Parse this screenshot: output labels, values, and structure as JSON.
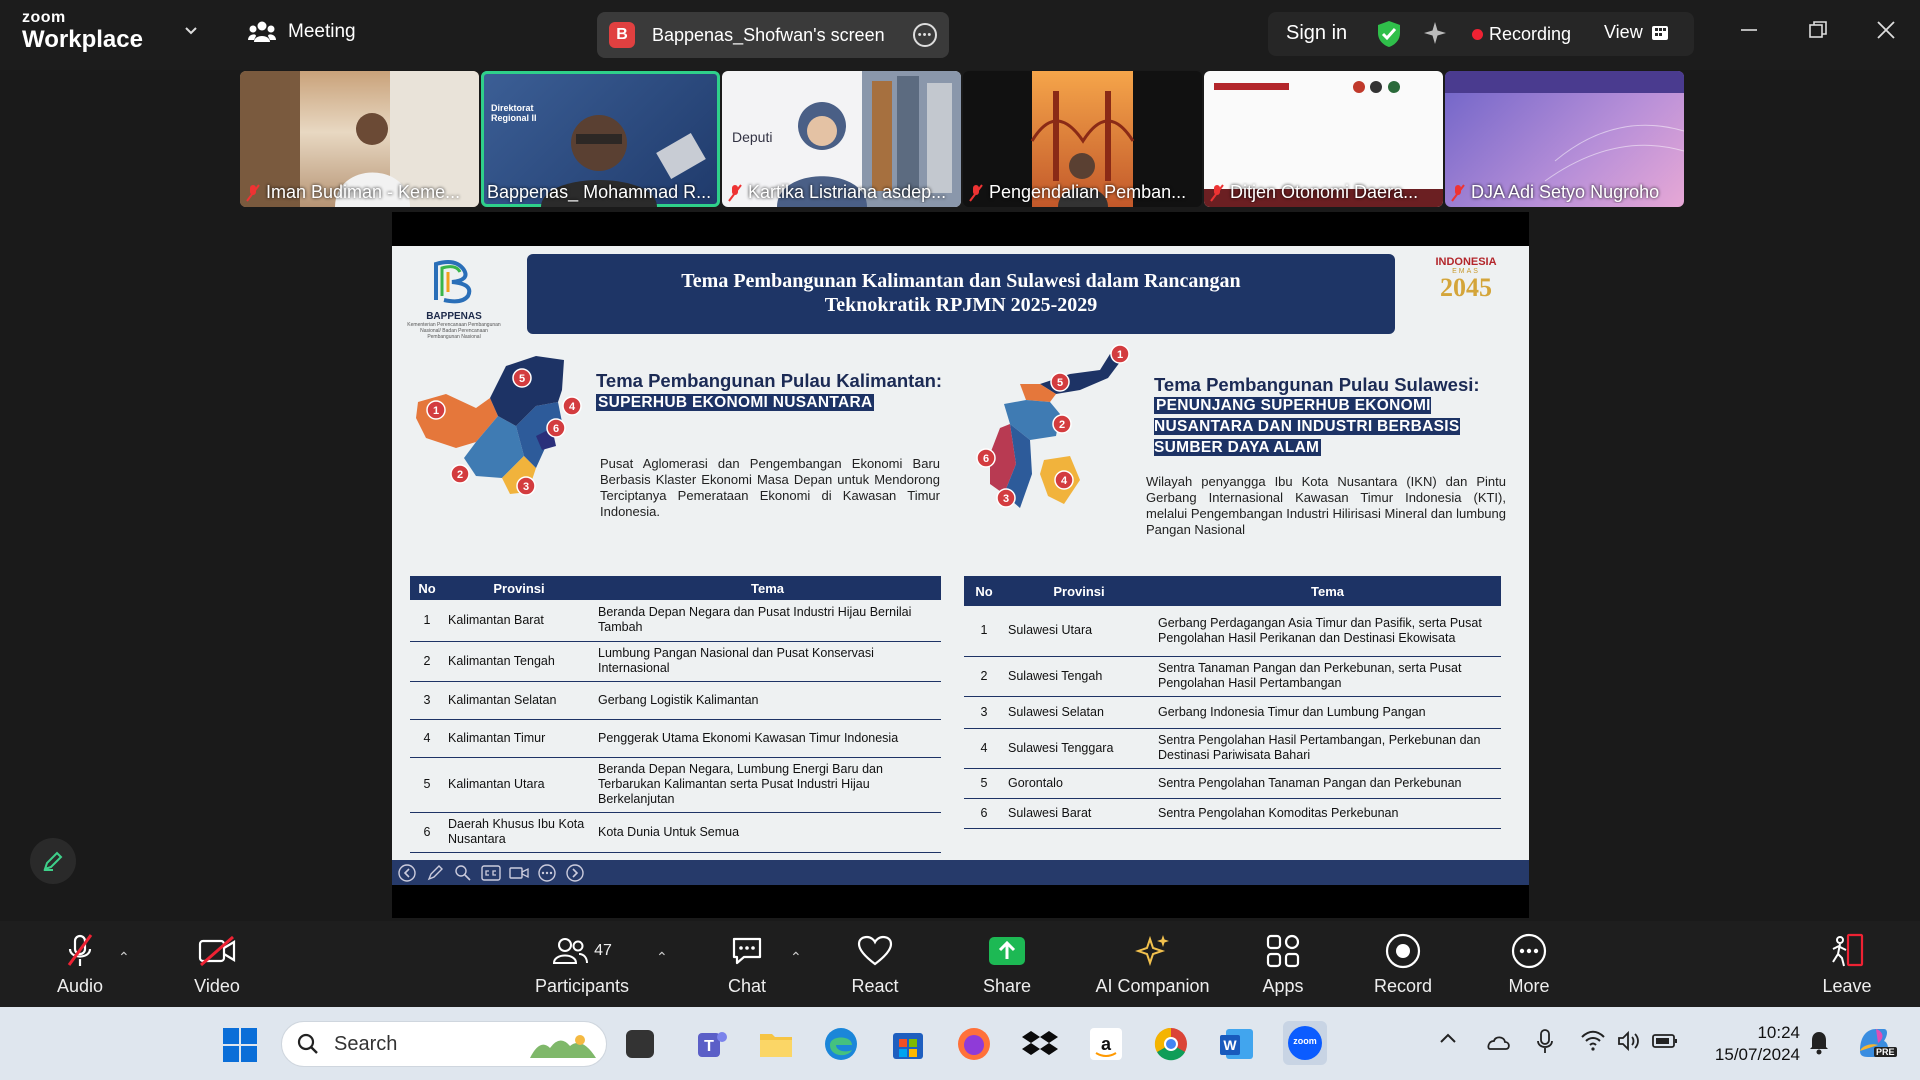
{
  "titlebar": {
    "brand_top": "zoom",
    "brand_bottom": "Workplace",
    "meeting_label": "Meeting",
    "share_badge": "B",
    "share_label": "Bappenas_Shofwan's screen",
    "signin": "Sign in",
    "recording": "Recording",
    "view": "View"
  },
  "participants_strip": [
    {
      "name": "Iman Budiman - Keme..."
    },
    {
      "name": "Bappenas_ Mohammad R..."
    },
    {
      "name": "Kartika Listriana asdep..."
    },
    {
      "name": "Pengendalian Pemban..."
    },
    {
      "name": "Ditjen Otonomi Daera..."
    },
    {
      "name": "DJA Adi Setyo Nugroho"
    }
  ],
  "thumb_overlay": {
    "direktorat": "Direktorat Regional II",
    "deputi": "Deputi"
  },
  "slide": {
    "logo_name": "BAPPENAS",
    "logo_sub": "Kementerian Perencanaan Pembangunan Nasional/ Badan Perencanaan Pembangunan Nasional",
    "title_line1": "Tema Pembangunan Kalimantan dan Sulawesi dalam Rancangan",
    "title_line2": "Teknokratik RPJMN 2025-2029",
    "emas_top": "INDONESIA",
    "emas_mid": "EMAS",
    "emas_year": "2045",
    "kalimantan": {
      "heading": "Tema Pembangunan Pulau Kalimantan:",
      "highlight": "SUPERHUB EKONOMI NUSANTARA",
      "description": "Pusat Aglomerasi dan Pengembangan Ekonomi Baru Berbasis Klaster Ekonomi Masa Depan untuk Mendorong Terciptanya Pemerataan Ekonomi di Kawasan Timur Indonesia.",
      "headers": [
        "No",
        "Provinsi",
        "Tema"
      ],
      "rows": [
        {
          "no": "1",
          "prov": "Kalimantan Barat",
          "tema": "Beranda Depan Negara dan Pusat Industri Hijau Bernilai Tambah"
        },
        {
          "no": "2",
          "prov": "Kalimantan Tengah",
          "tema": "Lumbung Pangan Nasional dan Pusat Konservasi Internasional"
        },
        {
          "no": "3",
          "prov": "Kalimantan Selatan",
          "tema": "Gerbang Logistik Kalimantan"
        },
        {
          "no": "4",
          "prov": "Kalimantan Timur",
          "tema": "Penggerak Utama Ekonomi Kawasan Timur Indonesia"
        },
        {
          "no": "5",
          "prov": "Kalimantan Utara",
          "tema": "Beranda Depan Negara, Lumbung Energi Baru dan Terbarukan Kalimantan serta Pusat Industri Hijau Berkelanjutan"
        },
        {
          "no": "6",
          "prov": "Daerah Khusus Ibu Kota Nusantara",
          "tema": "Kota Dunia Untuk Semua"
        }
      ]
    },
    "sulawesi": {
      "heading": "Tema Pembangunan Pulau Sulawesi:",
      "highlight": "PENUNJANG SUPERHUB EKONOMI NUSANTARA DAN INDUSTRI BERBASIS SUMBER DAYA ALAM",
      "description": "Wilayah penyangga Ibu Kota Nusantara (IKN) dan Pintu Gerbang Internasional Kawasan Timur Indonesia (KTI), melalui Pengembangan Industri Hilirisasi Mineral dan lumbung Pangan Nasional",
      "headers": [
        "No",
        "Provinsi",
        "Tema"
      ],
      "rows": [
        {
          "no": "1",
          "prov": "Sulawesi Utara",
          "tema": "Gerbang Perdagangan Asia Timur dan Pasifik, serta Pusat Pengolahan Hasil Perikanan dan Destinasi Ekowisata"
        },
        {
          "no": "2",
          "prov": "Sulawesi Tengah",
          "tema": "Sentra Tanaman Pangan dan Perkebunan, serta Pusat Pengolahan Hasil Pertambangan"
        },
        {
          "no": "3",
          "prov": "Sulawesi Selatan",
          "tema": "Gerbang Indonesia Timur dan Lumbung Pangan"
        },
        {
          "no": "4",
          "prov": "Sulawesi Tenggara",
          "tema": "Sentra Pengolahan Hasil Pertambangan, Perkebunan dan Destinasi Pariwisata Bahari"
        },
        {
          "no": "5",
          "prov": "Gorontalo",
          "tema": "Sentra Pengolahan Tanaman Pangan dan Perkebunan"
        },
        {
          "no": "6",
          "prov": "Sulawesi Barat",
          "tema": "Sentra Pengolahan Komoditas Perkebunan"
        }
      ]
    },
    "map_markers": [
      "1",
      "2",
      "3",
      "4",
      "5",
      "6"
    ]
  },
  "toolbar": {
    "audio": "Audio",
    "video": "Video",
    "participants": "Participants",
    "participants_count": "47",
    "chat": "Chat",
    "react": "React",
    "share": "Share",
    "ai_companion": "AI Companion",
    "apps": "Apps",
    "record": "Record",
    "more": "More",
    "leave": "Leave"
  },
  "taskbar": {
    "search": "Search",
    "time": "10:24",
    "date": "15/07/2024",
    "zoom_label": "zoom",
    "copilot_badge": "PRE"
  },
  "colors": {
    "navy": "#1d3365",
    "recording": "#e22233",
    "active_border": "#2fd08a",
    "share_green": "#1db954"
  }
}
